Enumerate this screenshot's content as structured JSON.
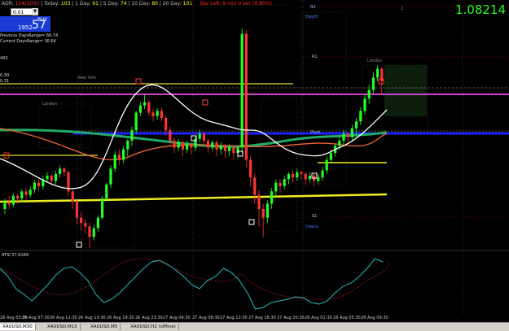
{
  "hud": {
    "adr_label": "ADR:",
    "adr_value": "114(10%)",
    "today_label": "Today:",
    "today_value": "103",
    "day1_label": "1 Day:",
    "day1_value": "91",
    "day5_label": "5 Day:",
    "day5_value": "74",
    "day10_label": "10 Day:",
    "day10_value": "80",
    "day20_label": "20 Day:",
    "day20_value": "101",
    "banner": "Bar Left: 9 min 0 sec (0.85%)"
  },
  "price": "1.08214",
  "trade_panel": {
    "lot": "0.01",
    "buy_label": "BUY",
    "buy_small": "1952",
    "buy_big": "57"
  },
  "info_lines": [
    "Previous DaysRange= 66.74",
    "Current DaysRange= 36.64",
    "",
    "",
    "493",
    "",
    "",
    "0.30",
    "0.31"
  ],
  "levels": {
    "r2": "R2",
    "dayhi": "DayHi",
    "r1": "R1",
    "pivot": "Pivot",
    "s1": "S1",
    "daylo": "DayLo",
    "r2_right": "2",
    "newyork": "New York",
    "london": "London",
    "london2": "London"
  },
  "oscillator_label": "ATSI 57.6169",
  "time_labels": [
    "26 Aug 03:30",
    "26 Aug 07:30",
    "26 Aug 11:30",
    "26 Aug 15:30",
    "26 Aug 19:30",
    "26 Aug 23:30",
    "27 Aug 04:30",
    "27 Aug 08:30",
    "27 Aug 12:30",
    "27 Aug 16:30",
    "27 Aug 20:30",
    "28 Aug 01:30",
    "28 Aug 05:30",
    "28 Aug 09:30"
  ],
  "tabs": [
    "XAUUSD,M30",
    "XAUUSD,M15",
    "XAUUSD,M5",
    "XAUUSD,H2 (offline)"
  ],
  "chart_data": {
    "type": "candlestick",
    "candles": [
      [
        40,
        48,
        52,
        34
      ],
      [
        48,
        45,
        55,
        40
      ],
      [
        45,
        55,
        58,
        42
      ],
      [
        55,
        52,
        57,
        46
      ],
      [
        52,
        60,
        63,
        48
      ],
      [
        60,
        56,
        64,
        50
      ],
      [
        56,
        62,
        66,
        53
      ],
      [
        62,
        70,
        73,
        58
      ],
      [
        70,
        66,
        74,
        60
      ],
      [
        66,
        74,
        78,
        62
      ],
      [
        74,
        78,
        82,
        70
      ],
      [
        78,
        72,
        80,
        66
      ],
      [
        72,
        80,
        84,
        68
      ],
      [
        80,
        86,
        90,
        76
      ],
      [
        86,
        82,
        88,
        77
      ],
      [
        82,
        60,
        84,
        55
      ],
      [
        60,
        48,
        62,
        40
      ],
      [
        48,
        30,
        50,
        22
      ],
      [
        30,
        24,
        36,
        15
      ],
      [
        24,
        20,
        28,
        12
      ],
      [
        20,
        8,
        24,
        -5
      ],
      [
        8,
        18,
        22,
        4
      ],
      [
        18,
        30,
        33,
        14
      ],
      [
        30,
        52,
        55,
        28
      ],
      [
        52,
        68,
        70,
        48
      ],
      [
        68,
        86,
        90,
        64
      ],
      [
        86,
        102,
        106,
        82
      ],
      [
        102,
        96,
        108,
        90
      ],
      [
        96,
        108,
        112,
        92
      ],
      [
        108,
        118,
        120,
        100
      ],
      [
        118,
        130,
        134,
        112
      ],
      [
        130,
        150,
        152,
        126
      ],
      [
        150,
        158,
        162,
        146
      ],
      [
        158,
        162,
        170,
        154
      ],
      [
        162,
        150,
        164,
        146
      ],
      [
        150,
        146,
        154,
        140
      ],
      [
        146,
        152,
        155,
        142
      ],
      [
        152,
        144,
        156,
        140
      ],
      [
        144,
        130,
        146,
        124
      ],
      [
        130,
        118,
        134,
        112
      ],
      [
        118,
        110,
        122,
        104
      ],
      [
        110,
        116,
        120,
        106
      ],
      [
        116,
        108,
        118,
        100
      ],
      [
        108,
        114,
        118,
        104
      ],
      [
        114,
        110,
        116,
        102
      ],
      [
        110,
        120,
        124,
        106
      ],
      [
        120,
        126,
        130,
        116
      ],
      [
        126,
        118,
        128,
        112
      ],
      [
        118,
        110,
        120,
        104
      ],
      [
        110,
        116,
        118,
        106
      ],
      [
        116,
        108,
        118,
        100
      ],
      [
        108,
        112,
        116,
        102
      ],
      [
        112,
        106,
        114,
        98
      ],
      [
        106,
        110,
        114,
        100
      ],
      [
        110,
        104,
        112,
        96
      ],
      [
        104,
        110,
        112,
        98
      ],
      [
        110,
        240,
        246,
        104
      ],
      [
        240,
        96,
        244,
        88
      ],
      [
        96,
        76,
        100,
        66
      ],
      [
        76,
        56,
        80,
        46
      ],
      [
        56,
        40,
        62,
        20
      ],
      [
        40,
        30,
        46,
        8
      ],
      [
        30,
        46,
        50,
        24
      ],
      [
        46,
        60,
        64,
        40
      ],
      [
        60,
        70,
        74,
        54
      ],
      [
        70,
        66,
        74,
        58
      ],
      [
        66,
        74,
        78,
        62
      ],
      [
        74,
        80,
        82,
        68
      ],
      [
        80,
        76,
        84,
        70
      ],
      [
        76,
        82,
        86,
        72
      ],
      [
        82,
        80,
        84,
        74
      ],
      [
        80,
        74,
        82,
        68
      ],
      [
        74,
        78,
        82,
        70
      ],
      [
        78,
        72,
        80,
        66
      ],
      [
        72,
        76,
        80,
        68
      ],
      [
        76,
        84,
        88,
        72
      ],
      [
        84,
        96,
        100,
        80
      ],
      [
        96,
        104,
        108,
        92
      ],
      [
        104,
        112,
        114,
        100
      ],
      [
        112,
        118,
        122,
        108
      ],
      [
        118,
        126,
        130,
        114
      ],
      [
        126,
        122,
        128,
        116
      ],
      [
        122,
        132,
        136,
        118
      ],
      [
        132,
        140,
        144,
        126
      ],
      [
        140,
        152,
        156,
        136
      ],
      [
        152,
        166,
        170,
        148
      ],
      [
        166,
        176,
        182,
        160
      ],
      [
        176,
        190,
        196,
        172
      ],
      [
        190,
        200,
        204,
        186
      ],
      [
        200,
        186,
        202,
        170
      ]
    ],
    "y_range": [
      0,
      260
    ]
  }
}
